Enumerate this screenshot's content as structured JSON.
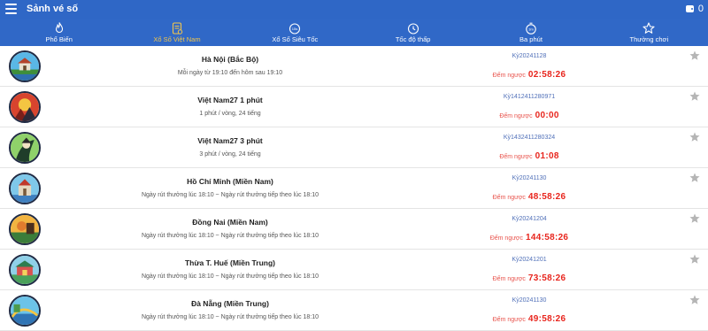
{
  "app": {
    "title": "Sảnh vé số",
    "balance": "0"
  },
  "tabs": [
    {
      "label": "Phổ Biến",
      "icon": "flame-icon"
    },
    {
      "label": "Xổ Số Việt Nam",
      "icon": "ticket-icon",
      "active": true
    },
    {
      "label": "Xổ Số Siêu Tốc",
      "icon": "gauge-icon"
    },
    {
      "label": "Tốc độ thấp",
      "icon": "clock-icon"
    },
    {
      "label": "Ba phút",
      "icon": "timer-icon"
    },
    {
      "label": "Thường chơi",
      "icon": "star-outline-icon"
    }
  ],
  "lotteries": [
    {
      "name": "Hà Nội (Bắc Bộ)",
      "schedule": "Mỗi ngày từ 19:10 đến hôm sau 19:10",
      "period": "Kỳ20241128",
      "countdown_label": "Đếm ngược",
      "countdown": "02:58:26"
    },
    {
      "name": "Việt Nam27 1 phút",
      "schedule": "1 phút / vòng, 24 tiếng",
      "period": "Kỳ1412411280971",
      "countdown_label": "Đếm ngược",
      "countdown": "00:00"
    },
    {
      "name": "Việt Nam27 3 phút",
      "schedule": "3 phút / vòng, 24 tiếng",
      "period": "Kỳ1432411280324",
      "countdown_label": "Đếm ngược",
      "countdown": "01:08"
    },
    {
      "name": "Hồ Chí Minh (Miền Nam)",
      "schedule": "Ngày rút thưởng lúc 18:10 ~ Ngày rút thưởng tiếp theo lúc 18:10",
      "period": "Kỳ20241130",
      "countdown_label": "Đếm ngược",
      "countdown": "48:58:26"
    },
    {
      "name": "Đồng Nai (Miền Nam)",
      "schedule": "Ngày rút thưởng lúc 18:10 ~ Ngày rút thưởng tiếp theo lúc 18:10",
      "period": "Kỳ20241204",
      "countdown_label": "Đếm ngược",
      "countdown": "144:58:26"
    },
    {
      "name": "Thừa T. Huế (Miền Trung)",
      "schedule": "Ngày rút thưởng lúc 18:10 ~ Ngày rút thưởng tiếp theo lúc 18:10",
      "period": "Kỳ20241201",
      "countdown_label": "Đếm ngược",
      "countdown": "73:58:26"
    },
    {
      "name": "Đà Nẵng (Miền Trung)",
      "schedule": "Ngày rút thưởng lúc 18:10 ~ Ngày rút thưởng tiếp theo lúc 18:10",
      "period": "Kỳ20241130",
      "countdown_label": "Đếm ngược",
      "countdown": "49:58:26"
    }
  ],
  "colors": {
    "header": "#2f67c6",
    "active_tab": "#f3c64a",
    "countdown": "#e8251d",
    "period": "#4f6fb8"
  }
}
